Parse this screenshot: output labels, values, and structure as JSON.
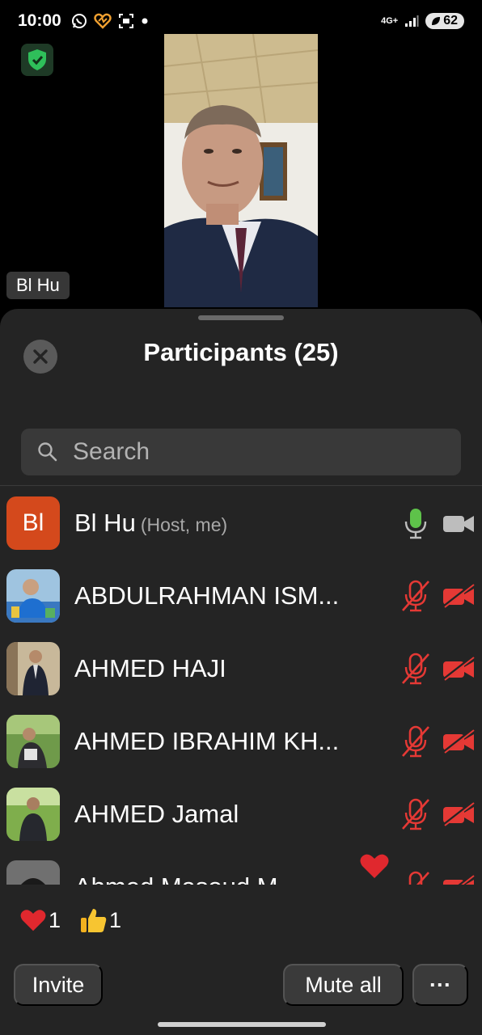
{
  "status_bar": {
    "time": "10:00",
    "network": "4G+",
    "battery": "62"
  },
  "video": {
    "name_tag": "Bl Hu"
  },
  "participants_panel": {
    "title": "Participants (25)",
    "search_placeholder": "Search",
    "participants": [
      {
        "name": "Bl Hu",
        "role": "(Host, me)",
        "avatar_initials": "Bl",
        "mic": "on",
        "camera": "off"
      },
      {
        "name": "ABDULRAHMAN ISM...",
        "mic": "muted",
        "camera": "disabled"
      },
      {
        "name": "AHMED HAJI",
        "mic": "muted",
        "camera": "disabled"
      },
      {
        "name": "AHMED IBRAHIM KH...",
        "mic": "muted",
        "camera": "disabled"
      },
      {
        "name": "AHMED Jamal",
        "mic": "muted",
        "camera": "disabled"
      },
      {
        "name": "Ahmed Masoud M...",
        "mic": "muted",
        "camera": "disabled",
        "reaction": "heart-icon"
      }
    ]
  },
  "reactions": [
    {
      "icon": "heart-icon",
      "count": "1"
    },
    {
      "icon": "thumbs-up-icon",
      "count": "1"
    }
  ],
  "actions": {
    "invite": "Invite",
    "mute_all": "Mute all",
    "more": "···"
  },
  "colors": {
    "sheet_bg": "#242424",
    "host_avatar": "#d4491c",
    "mic_active": "#5ec24a",
    "muted_red": "#e53935"
  }
}
